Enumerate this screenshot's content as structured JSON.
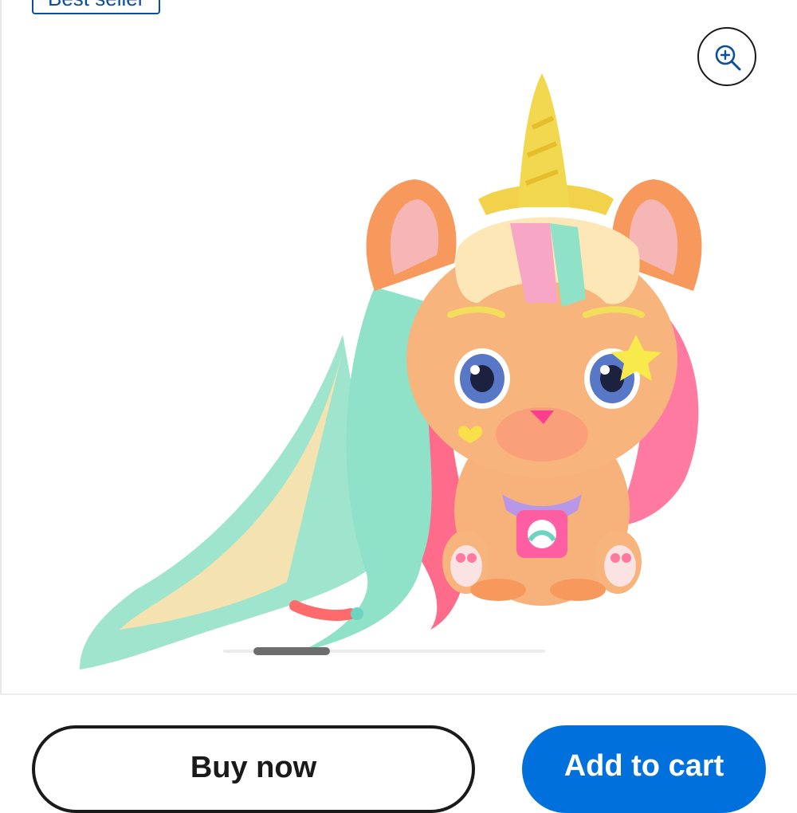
{
  "badge": {
    "label": "Best seller"
  },
  "gallery": {
    "image_alt": "Unicorn kitty toy with rainbow hair",
    "zoom_icon": "zoom-in-icon"
  },
  "actions": {
    "buy_now_label": "Buy now",
    "add_to_cart_label": "Add to cart"
  },
  "colors": {
    "accent": "#0071dc",
    "badge": "#0b4f9c",
    "text": "#1a1a1a"
  }
}
